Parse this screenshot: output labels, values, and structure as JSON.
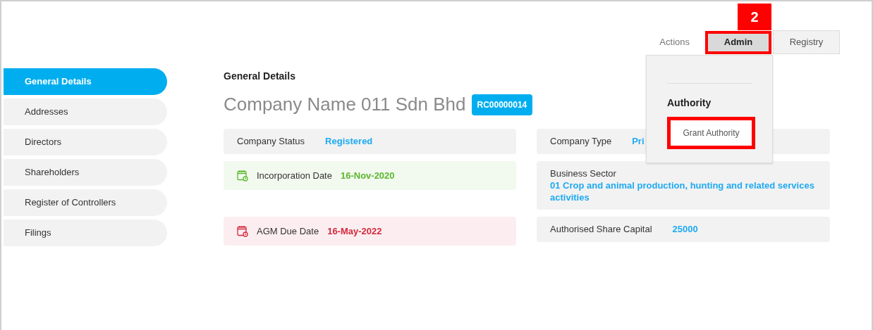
{
  "tabs": [
    {
      "label": "Actions",
      "selected": false,
      "highlighted": false
    },
    {
      "label": "Admin",
      "selected": true,
      "highlighted": true
    },
    {
      "label": "Registry",
      "selected": false,
      "highlighted": false
    }
  ],
  "step_badge": "2",
  "admin_menu": {
    "heading": "Authority",
    "items": [
      {
        "label": "Grant Authority",
        "highlighted": true
      }
    ]
  },
  "sidebar": {
    "items": [
      {
        "label": "General Details",
        "selected": true
      },
      {
        "label": "Addresses",
        "selected": false
      },
      {
        "label": "Directors",
        "selected": false
      },
      {
        "label": "Shareholders",
        "selected": false
      },
      {
        "label": "Register of Controllers",
        "selected": false
      },
      {
        "label": "Filings",
        "selected": false
      }
    ]
  },
  "section_title": "General Details",
  "company_name": "Company Name 011 Sdn Bhd",
  "registration_number": "RC00000014",
  "left_fields": [
    {
      "kind": "plain",
      "label": "Company Status",
      "value": "Registered"
    },
    {
      "kind": "date",
      "label": "Incorporation Date",
      "value": "16-Nov-2020",
      "color": "#5cb82e"
    },
    {
      "kind": "date",
      "label": "AGM Due Date",
      "value": "16-May-2022",
      "color": "#d3283c"
    }
  ],
  "right_fields": [
    {
      "kind": "inline",
      "label": "Company Type",
      "value": "Pri"
    },
    {
      "kind": "stacked",
      "label": "Business Sector",
      "value": "01 Crop and animal production, hunting and related services activities"
    },
    {
      "kind": "inline",
      "label": "Authorised Share Capital",
      "value": "25000"
    }
  ]
}
